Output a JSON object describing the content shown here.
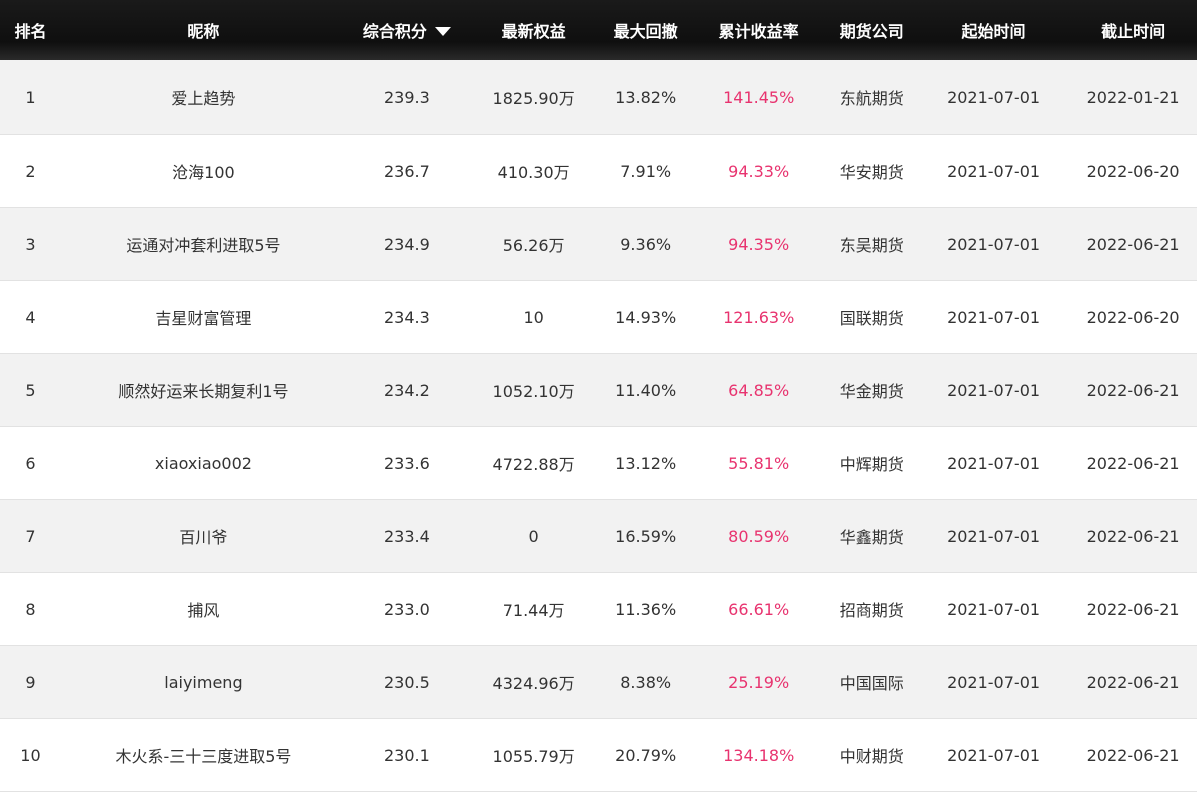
{
  "headers": {
    "rank": "排名",
    "name": "昵称",
    "score": "综合积分",
    "equity": "最新权益",
    "drawdown": "最大回撤",
    "return": "累计收益率",
    "firm": "期货公司",
    "start": "起始时间",
    "end": "截止时间"
  },
  "sort": {
    "column": "score",
    "direction": "descending",
    "icon": "caret-down-icon"
  },
  "colors": {
    "return_value": "#e8336f",
    "header_bg": "#111111",
    "row_alt_bg": "#f2f2f2"
  },
  "rows": [
    {
      "rank": "1",
      "name": "爱上趋势",
      "score": "239.3",
      "equity": "1825.90万",
      "drawdown": "13.82%",
      "return": "141.45%",
      "firm": "东航期货",
      "start": "2021-07-01",
      "end": "2022-01-21"
    },
    {
      "rank": "2",
      "name": "沧海100",
      "score": "236.7",
      "equity": "410.30万",
      "drawdown": "7.91%",
      "return": "94.33%",
      "firm": "华安期货",
      "start": "2021-07-01",
      "end": "2022-06-20"
    },
    {
      "rank": "3",
      "name": "运通对冲套利进取5号",
      "score": "234.9",
      "equity": "56.26万",
      "drawdown": "9.36%",
      "return": "94.35%",
      "firm": "东吴期货",
      "start": "2021-07-01",
      "end": "2022-06-21"
    },
    {
      "rank": "4",
      "name": "吉星财富管理",
      "score": "234.3",
      "equity": "10",
      "drawdown": "14.93%",
      "return": "121.63%",
      "firm": "国联期货",
      "start": "2021-07-01",
      "end": "2022-06-20"
    },
    {
      "rank": "5",
      "name": "顺然好运来长期复利1号",
      "score": "234.2",
      "equity": "1052.10万",
      "drawdown": "11.40%",
      "return": "64.85%",
      "firm": "华金期货",
      "start": "2021-07-01",
      "end": "2022-06-21"
    },
    {
      "rank": "6",
      "name": "xiaoxiao002",
      "score": "233.6",
      "equity": "4722.88万",
      "drawdown": "13.12%",
      "return": "55.81%",
      "firm": "中辉期货",
      "start": "2021-07-01",
      "end": "2022-06-21"
    },
    {
      "rank": "7",
      "name": "百川爷",
      "score": "233.4",
      "equity": "0",
      "drawdown": "16.59%",
      "return": "80.59%",
      "firm": "华鑫期货",
      "start": "2021-07-01",
      "end": "2022-06-21"
    },
    {
      "rank": "8",
      "name": "捕风",
      "score": "233.0",
      "equity": "71.44万",
      "drawdown": "11.36%",
      "return": "66.61%",
      "firm": "招商期货",
      "start": "2021-07-01",
      "end": "2022-06-21"
    },
    {
      "rank": "9",
      "name": "laiyimeng",
      "score": "230.5",
      "equity": "4324.96万",
      "drawdown": "8.38%",
      "return": "25.19%",
      "firm": "中国国际",
      "start": "2021-07-01",
      "end": "2022-06-21"
    },
    {
      "rank": "10",
      "name": "木火系-三十三度进取5号",
      "score": "230.1",
      "equity": "1055.79万",
      "drawdown": "20.79%",
      "return": "134.18%",
      "firm": "中财期货",
      "start": "2021-07-01",
      "end": "2022-06-21"
    }
  ]
}
